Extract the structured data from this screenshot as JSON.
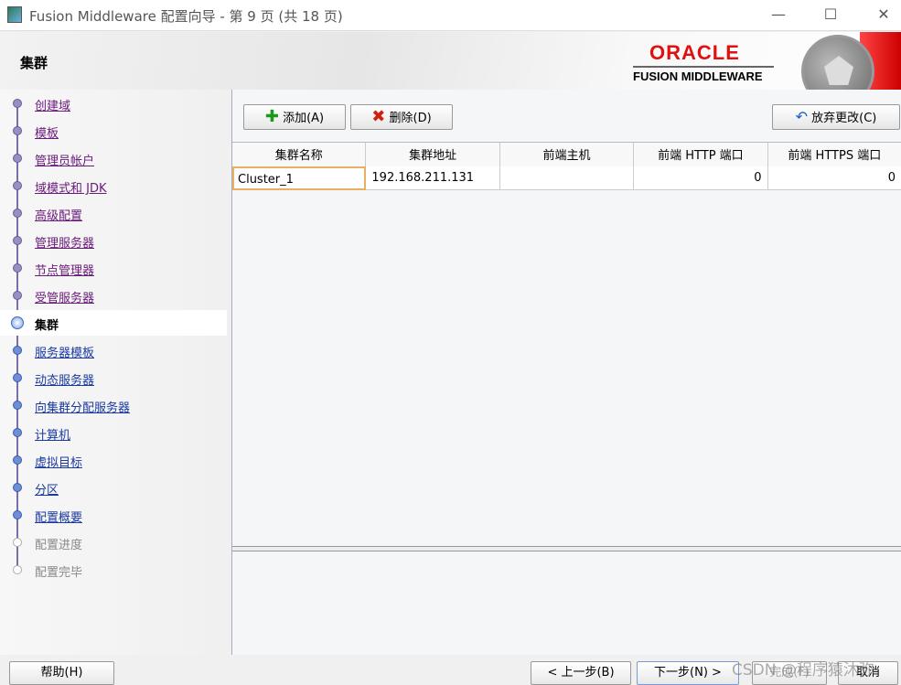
{
  "window": {
    "title": "Fusion Middleware 配置向导 - 第 9 页 (共 18 页)",
    "minimize": "—",
    "maximize": "☐",
    "close": "✕"
  },
  "header": {
    "title": "集群",
    "logo_top": "ORACLE",
    "logo_bottom": "FUSION MIDDLEWARE"
  },
  "sidebar": {
    "items": [
      {
        "label": "创建域",
        "state": "visited"
      },
      {
        "label": "模板",
        "state": "visited"
      },
      {
        "label": "管理员帐户",
        "state": "visited"
      },
      {
        "label": "域模式和 JDK",
        "state": "visited"
      },
      {
        "label": "高级配置",
        "state": "visited"
      },
      {
        "label": "管理服务器",
        "state": "visited"
      },
      {
        "label": "节点管理器",
        "state": "visited"
      },
      {
        "label": "受管服务器",
        "state": "visited"
      },
      {
        "label": "集群",
        "state": "active"
      },
      {
        "label": "服务器模板",
        "state": "link"
      },
      {
        "label": "动态服务器",
        "state": "link"
      },
      {
        "label": "向集群分配服务器",
        "state": "link"
      },
      {
        "label": "计算机",
        "state": "link"
      },
      {
        "label": "虚拟目标",
        "state": "link"
      },
      {
        "label": "分区",
        "state": "link"
      },
      {
        "label": "配置概要",
        "state": "link"
      },
      {
        "label": "配置进度",
        "state": "disabled"
      },
      {
        "label": "配置完毕",
        "state": "disabled"
      }
    ]
  },
  "toolbar": {
    "add": "添加(A)",
    "delete": "删除(D)",
    "revert": "放弃更改(C)"
  },
  "table": {
    "columns": [
      "集群名称",
      "集群地址",
      "前端主机",
      "前端 HTTP 端口",
      "前端 HTTPS 端口"
    ],
    "rows": [
      [
        "Cluster_1",
        "192.168.211.131",
        "",
        "0",
        "0"
      ]
    ]
  },
  "footer": {
    "help": "帮助(H)",
    "back": "< 上一步(B)",
    "next": "下一步(N) >",
    "finish": "完成(F)",
    "cancel": "取消"
  },
  "watermark": "CSDN @程序猿沐弥"
}
